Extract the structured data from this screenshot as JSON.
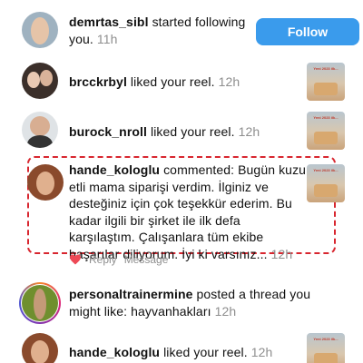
{
  "notifications": [
    {
      "user": "demrtas_sibl",
      "message": " started following you.",
      "time": "11h",
      "action_label": "Follow"
    },
    {
      "user": "brcckrbyl",
      "message": " liked your reel.",
      "time": "12h",
      "thumb_caption": "Yeni 2023 ilk..."
    },
    {
      "user": "burock_nroll",
      "message": " liked your reel.",
      "time": "12h",
      "thumb_caption": "Yeni 2023 ilk..."
    },
    {
      "user": "hande_kologlu",
      "message": " commented: Bugün kuzu etli mama siparişi verdim. İlginiz ve desteğiniz için çok teşekkür ederim. Bu kadar ilgili bir şirket ile ilk defa karşılaştım. Çalışanlara tüm ekibe başarılar diliyorum. İyi ki varsınız...",
      "time": "12h",
      "reply_label": "Reply",
      "message_label": "Message",
      "thumb_caption": "Yeni 2023 ilk..."
    },
    {
      "user": "personaltrainermine",
      "message": " posted a thread you might like: hayvanhakları",
      "time": "12h"
    },
    {
      "user": "hande_kologlu",
      "message": " liked your reel.",
      "time": "12h",
      "thumb_caption": "Yeni 2023 ilk..."
    }
  ],
  "colors": {
    "follow_button": "#3a9bec",
    "highlight_border": "#d8262f",
    "heart": "#ed4956",
    "secondary_text": "#8e8e8e"
  }
}
